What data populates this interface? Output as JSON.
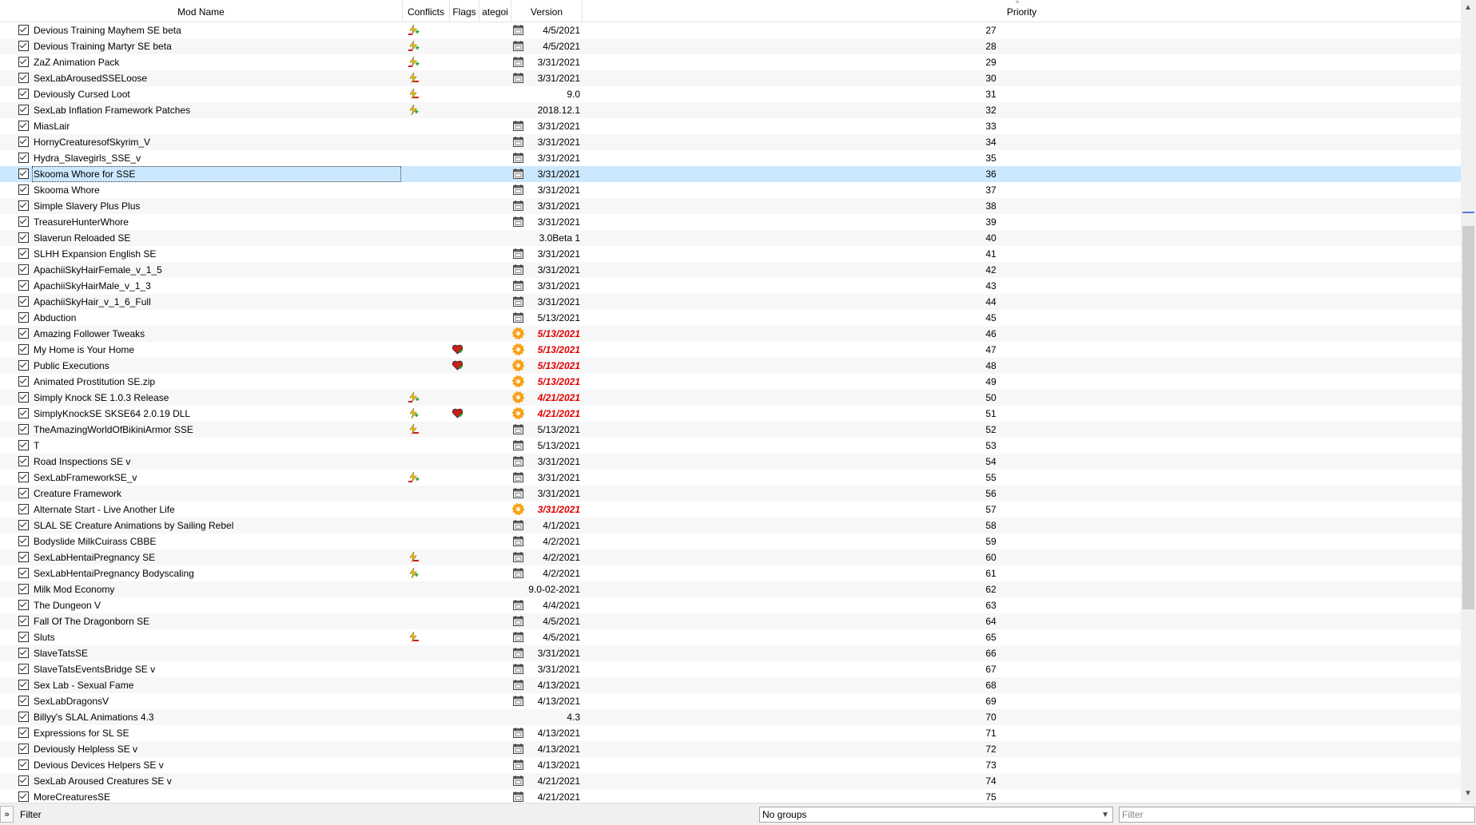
{
  "columns": {
    "mod_name": "Mod Name",
    "conflicts": "Conflicts",
    "flags": "Flags",
    "category": "ategoi",
    "version": "Version",
    "priority": "Priority"
  },
  "colors": {
    "selected_row": "#cce8ff",
    "alt_row": "#f7f7f7",
    "warn_version": "#e00000"
  },
  "mods": [
    {
      "name": "Devious Training Mayhem SE beta",
      "conflict": "overwrite-both-icon",
      "flag": null,
      "category": "calendar-icon",
      "version": "4/5/2021",
      "version_warn": false,
      "priority": "27"
    },
    {
      "name": "Devious Training Martyr SE beta",
      "conflict": "overwrite-both-icon",
      "flag": null,
      "category": "calendar-icon",
      "version": "4/5/2021",
      "version_warn": false,
      "priority": "28"
    },
    {
      "name": "ZaZ Animation Pack",
      "conflict": "overwrite-both-icon",
      "flag": null,
      "category": "calendar-icon",
      "version": "3/31/2021",
      "version_warn": false,
      "priority": "29"
    },
    {
      "name": "SexLabArousedSSELoose",
      "conflict": "overwritten-icon",
      "flag": null,
      "category": "calendar-icon",
      "version": "3/31/2021",
      "version_warn": false,
      "priority": "30"
    },
    {
      "name": "Deviously Cursed Loot",
      "conflict": "overwritten-icon",
      "flag": null,
      "category": null,
      "version": "9.0",
      "version_warn": false,
      "priority": "31"
    },
    {
      "name": "SexLab Inflation Framework Patches",
      "conflict": "overwrite-icon",
      "flag": null,
      "category": null,
      "version": "2018.12.1",
      "version_warn": false,
      "priority": "32"
    },
    {
      "name": "MiasLair",
      "conflict": null,
      "flag": null,
      "category": "calendar-icon",
      "version": "3/31/2021",
      "version_warn": false,
      "priority": "33"
    },
    {
      "name": "HornyCreaturesofSkyrim_V",
      "conflict": null,
      "flag": null,
      "category": "calendar-icon",
      "version": "3/31/2021",
      "version_warn": false,
      "priority": "34"
    },
    {
      "name": "Hydra_Slavegirls_SSE_v",
      "conflict": null,
      "flag": null,
      "category": "calendar-icon",
      "version": "3/31/2021",
      "version_warn": false,
      "priority": "35"
    },
    {
      "name": "Skooma Whore for SSE",
      "conflict": null,
      "flag": null,
      "category": "calendar-icon",
      "version": "3/31/2021",
      "version_warn": false,
      "priority": "36",
      "selected": true
    },
    {
      "name": "Skooma Whore",
      "conflict": null,
      "flag": null,
      "category": "calendar-icon",
      "version": "3/31/2021",
      "version_warn": false,
      "priority": "37"
    },
    {
      "name": "Simple Slavery Plus Plus",
      "conflict": null,
      "flag": null,
      "category": "calendar-icon",
      "version": "3/31/2021",
      "version_warn": false,
      "priority": "38"
    },
    {
      "name": "TreasureHunterWhore",
      "conflict": null,
      "flag": null,
      "category": "calendar-icon",
      "version": "3/31/2021",
      "version_warn": false,
      "priority": "39"
    },
    {
      "name": "Slaverun Reloaded SE",
      "conflict": null,
      "flag": null,
      "category": null,
      "version": "3.0Beta 1",
      "version_warn": false,
      "priority": "40"
    },
    {
      "name": "SLHH Expansion English SE",
      "conflict": null,
      "flag": null,
      "category": "calendar-icon",
      "version": "3/31/2021",
      "version_warn": false,
      "priority": "41"
    },
    {
      "name": "ApachiiSkyHairFemale_v_1_5",
      "conflict": null,
      "flag": null,
      "category": "calendar-icon",
      "version": "3/31/2021",
      "version_warn": false,
      "priority": "42"
    },
    {
      "name": "ApachiiSkyHairMale_v_1_3",
      "conflict": null,
      "flag": null,
      "category": "calendar-icon",
      "version": "3/31/2021",
      "version_warn": false,
      "priority": "43"
    },
    {
      "name": "ApachiiSkyHair_v_1_6_Full",
      "conflict": null,
      "flag": null,
      "category": "calendar-icon",
      "version": "3/31/2021",
      "version_warn": false,
      "priority": "44"
    },
    {
      "name": "Abduction",
      "conflict": null,
      "flag": null,
      "category": "calendar-icon",
      "version": "5/13/2021",
      "version_warn": false,
      "priority": "45"
    },
    {
      "name": "Amazing Follower Tweaks",
      "conflict": null,
      "flag": null,
      "category": "gear-warning-icon",
      "version": "5/13/2021",
      "version_warn": true,
      "priority": "46"
    },
    {
      "name": "My Home is Your Home",
      "conflict": null,
      "flag": "heart-flag-icon",
      "category": "gear-warning-icon",
      "version": "5/13/2021",
      "version_warn": true,
      "priority": "47"
    },
    {
      "name": "Public Executions",
      "conflict": null,
      "flag": "heart-flag-icon",
      "category": "gear-warning-icon",
      "version": "5/13/2021",
      "version_warn": true,
      "priority": "48"
    },
    {
      "name": "Animated Prostitution SE.zip",
      "conflict": null,
      "flag": null,
      "category": "gear-warning-icon",
      "version": "5/13/2021",
      "version_warn": true,
      "priority": "49"
    },
    {
      "name": "Simply Knock SE 1.0.3 Release",
      "conflict": "overwrite-both-icon",
      "flag": null,
      "category": "gear-warning-icon",
      "version": "4/21/2021",
      "version_warn": true,
      "priority": "50"
    },
    {
      "name": "SimplyKnockSE SKSE64 2.0.19 DLL",
      "conflict": "overwrite-icon",
      "flag": "heart-flag-icon",
      "category": "gear-warning-icon",
      "version": "4/21/2021",
      "version_warn": true,
      "priority": "51"
    },
    {
      "name": "TheAmazingWorldOfBikiniArmor SSE",
      "conflict": "overwritten-icon",
      "flag": null,
      "category": "calendar-icon",
      "version": "5/13/2021",
      "version_warn": false,
      "priority": "52"
    },
    {
      "name": "T",
      "conflict": null,
      "flag": null,
      "category": "calendar-icon",
      "version": "5/13/2021",
      "version_warn": false,
      "priority": "53"
    },
    {
      "name": "Road Inspections SE v",
      "conflict": null,
      "flag": null,
      "category": "calendar-icon",
      "version": "3/31/2021",
      "version_warn": false,
      "priority": "54"
    },
    {
      "name": "SexLabFrameworkSE_v",
      "conflict": "overwrite-both-icon",
      "flag": null,
      "category": "calendar-icon",
      "version": "3/31/2021",
      "version_warn": false,
      "priority": "55"
    },
    {
      "name": "Creature Framework",
      "conflict": null,
      "flag": null,
      "category": "calendar-icon",
      "version": "3/31/2021",
      "version_warn": false,
      "priority": "56"
    },
    {
      "name": "Alternate Start - Live Another Life",
      "conflict": null,
      "flag": null,
      "category": "gear-warning-icon",
      "version": "3/31/2021",
      "version_warn": true,
      "priority": "57"
    },
    {
      "name": "SLAL SE Creature Animations by Sailing Rebel",
      "conflict": null,
      "flag": null,
      "category": "calendar-icon",
      "version": "4/1/2021",
      "version_warn": false,
      "priority": "58"
    },
    {
      "name": "Bodyslide MilkCuirass CBBE",
      "conflict": null,
      "flag": null,
      "category": "calendar-icon",
      "version": "4/2/2021",
      "version_warn": false,
      "priority": "59"
    },
    {
      "name": "SexLabHentaiPregnancy SE",
      "conflict": "overwritten-icon",
      "flag": null,
      "category": "calendar-icon",
      "version": "4/2/2021",
      "version_warn": false,
      "priority": "60"
    },
    {
      "name": "SexLabHentaiPregnancy Bodyscaling",
      "conflict": "overwrite-icon",
      "flag": null,
      "category": "calendar-icon",
      "version": "4/2/2021",
      "version_warn": false,
      "priority": "61"
    },
    {
      "name": "Milk Mod Economy",
      "conflict": null,
      "flag": null,
      "category": null,
      "version": "9.0-02-2021",
      "version_warn": false,
      "priority": "62"
    },
    {
      "name": "The Dungeon V",
      "conflict": null,
      "flag": null,
      "category": "calendar-icon",
      "version": "4/4/2021",
      "version_warn": false,
      "priority": "63"
    },
    {
      "name": "Fall Of The Dragonborn SE",
      "conflict": null,
      "flag": null,
      "category": "calendar-icon",
      "version": "4/5/2021",
      "version_warn": false,
      "priority": "64"
    },
    {
      "name": "Sluts",
      "conflict": "overwritten-icon",
      "flag": null,
      "category": "calendar-icon",
      "version": "4/5/2021",
      "version_warn": false,
      "priority": "65"
    },
    {
      "name": "SlaveTatsSE",
      "conflict": null,
      "flag": null,
      "category": "calendar-icon",
      "version": "3/31/2021",
      "version_warn": false,
      "priority": "66"
    },
    {
      "name": "SlaveTatsEventsBridge SE v",
      "conflict": null,
      "flag": null,
      "category": "calendar-icon",
      "version": "3/31/2021",
      "version_warn": false,
      "priority": "67"
    },
    {
      "name": "Sex Lab - Sexual Fame",
      "conflict": null,
      "flag": null,
      "category": "calendar-icon",
      "version": "4/13/2021",
      "version_warn": false,
      "priority": "68"
    },
    {
      "name": "SexLabDragonsV",
      "conflict": null,
      "flag": null,
      "category": "calendar-icon",
      "version": "4/13/2021",
      "version_warn": false,
      "priority": "69"
    },
    {
      "name": "Billyy's SLAL Animations 4.3",
      "conflict": null,
      "flag": null,
      "category": null,
      "version": "4.3",
      "version_warn": false,
      "priority": "70"
    },
    {
      "name": "Expressions for SL SE",
      "conflict": null,
      "flag": null,
      "category": "calendar-icon",
      "version": "4/13/2021",
      "version_warn": false,
      "priority": "71"
    },
    {
      "name": "Deviously Helpless SE v",
      "conflict": null,
      "flag": null,
      "category": "calendar-icon",
      "version": "4/13/2021",
      "version_warn": false,
      "priority": "72"
    },
    {
      "name": "Devious Devices Helpers SE v",
      "conflict": null,
      "flag": null,
      "category": "calendar-icon",
      "version": "4/13/2021",
      "version_warn": false,
      "priority": "73"
    },
    {
      "name": "SexLab Aroused Creatures SE v",
      "conflict": null,
      "flag": null,
      "category": "calendar-icon",
      "version": "4/21/2021",
      "version_warn": false,
      "priority": "74"
    },
    {
      "name": "MoreCreaturesSE",
      "conflict": null,
      "flag": null,
      "category": "calendar-icon",
      "version": "4/21/2021",
      "version_warn": false,
      "priority": "75"
    }
  ],
  "footer": {
    "expand_glyph": "»",
    "filter_label": "Filter",
    "groups_value": "No groups",
    "filter_placeholder": "Filter"
  }
}
